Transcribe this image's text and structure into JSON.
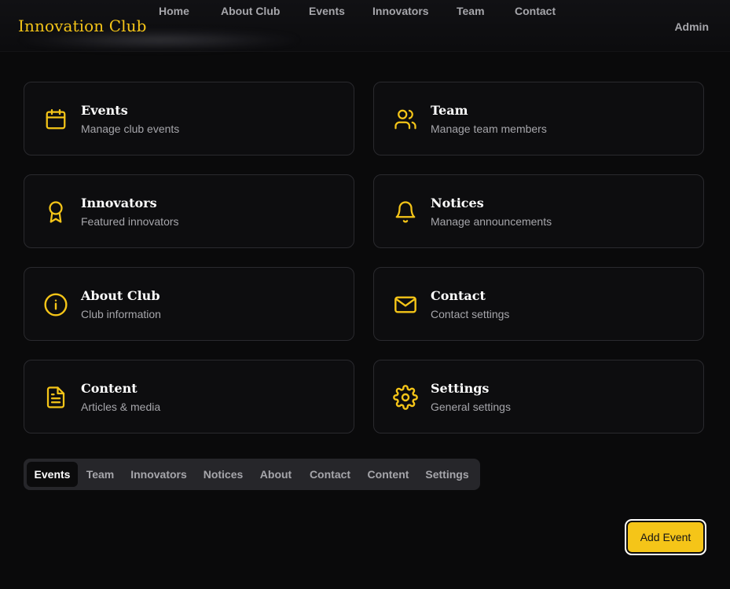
{
  "brand": {
    "name": "Innovation Club"
  },
  "nav": {
    "items": [
      "Home",
      "About Club",
      "Events",
      "Innovators",
      "Team",
      "Contact"
    ]
  },
  "user": {
    "label": "Admin"
  },
  "accent_color": "#f5c518",
  "cards": [
    {
      "title": "Events",
      "subtitle": "Manage club events",
      "icon": "calendar-icon"
    },
    {
      "title": "Team",
      "subtitle": "Manage team members",
      "icon": "users-icon"
    },
    {
      "title": "Innovators",
      "subtitle": "Featured innovators",
      "icon": "award-icon"
    },
    {
      "title": "Notices",
      "subtitle": "Manage announcements",
      "icon": "bell-icon"
    },
    {
      "title": "About Club",
      "subtitle": "Club information",
      "icon": "info-icon"
    },
    {
      "title": "Contact",
      "subtitle": "Contact settings",
      "icon": "mail-icon"
    },
    {
      "title": "Content",
      "subtitle": "Articles & media",
      "icon": "file-text-icon"
    },
    {
      "title": "Settings",
      "subtitle": "General settings",
      "icon": "gear-icon"
    }
  ],
  "tabs": {
    "items": [
      "Events",
      "Team",
      "Innovators",
      "Notices",
      "About",
      "Contact",
      "Content",
      "Settings"
    ],
    "active": "Events"
  },
  "actions": {
    "add_label": "Add Event"
  }
}
